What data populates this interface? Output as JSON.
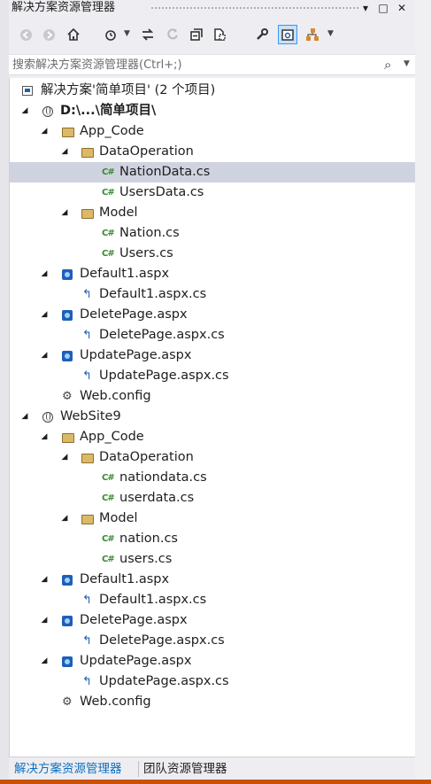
{
  "window": {
    "title": "解决方案资源管理器",
    "dropdown_glyph": "▾",
    "maximize_glyph": "□",
    "close_glyph": "✕"
  },
  "toolbar": {
    "icons": [
      "back-icon",
      "forward-icon",
      "home-icon",
      "sync-icon",
      "refresh-icon",
      "collapse-all-icon",
      "show-all-files-icon",
      "properties-icon",
      "preview-icon",
      "class-view-icon"
    ]
  },
  "search": {
    "placeholder": "搜索解决方案资源管理器(Ctrl+;)",
    "value": ""
  },
  "tree": {
    "solution": "解决方案'简单项目' (2 个项目)",
    "project1": "D:\\...\\简单项目\\",
    "p1_app_code": "App_Code",
    "p1_dataoperation": "DataOperation",
    "p1_nationdata": "NationData.cs",
    "p1_usersdata": "UsersData.cs",
    "p1_model": "Model",
    "p1_nation": "Nation.cs",
    "p1_users": "Users.cs",
    "p1_default1": "Default1.aspx",
    "p1_default1_cs": "Default1.aspx.cs",
    "p1_deletepage": "DeletePage.aspx",
    "p1_deletepage_cs": "DeletePage.aspx.cs",
    "p1_updatepage": "UpdatePage.aspx",
    "p1_updatepage_cs": "UpdatePage.aspx.cs",
    "p1_webconfig": "Web.config",
    "project2": "WebSite9",
    "p2_app_code": "App_Code",
    "p2_dataoperation": "DataOperation",
    "p2_nationdata": "nationdata.cs",
    "p2_userdata": "userdata.cs",
    "p2_model": "Model",
    "p2_nation": "nation.cs",
    "p2_users": "users.cs",
    "p2_default1": "Default1.aspx",
    "p2_default1_cs": "Default1.aspx.cs",
    "p2_deletepage": "DeletePage.aspx",
    "p2_deletepage_cs": "DeletePage.aspx.cs",
    "p2_updatepage": "UpdatePage.aspx",
    "p2_updatepage_cs": "UpdatePage.aspx.cs",
    "p2_webconfig": "Web.config",
    "selected": "p1_nationdata"
  },
  "bottom_tabs": {
    "solution_explorer": "解决方案资源管理器",
    "team_explorer": "团队资源管理器"
  },
  "colors": {
    "accent": "#3399ff",
    "selection": "#cfd3df",
    "status_bar": "#ca5100",
    "active_tab_text": "#0e70c0"
  }
}
